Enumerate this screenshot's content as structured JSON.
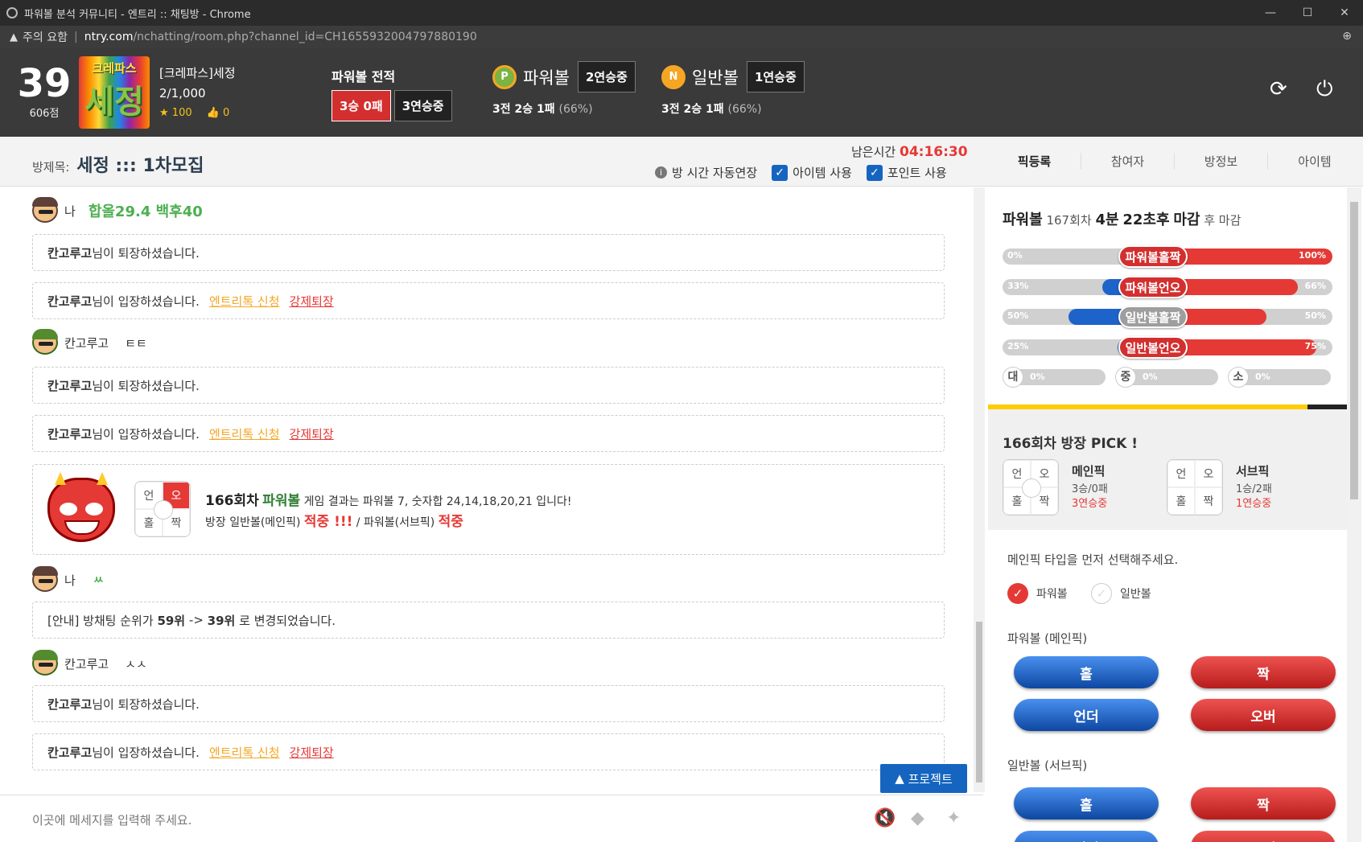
{
  "window": {
    "title": "파워볼 분석 커뮤니티 - 엔트리 :: 채팅방 - Chrome"
  },
  "address": {
    "warning": "주의 요함",
    "domain": "ntry.com",
    "path": "/nchatting/room.php?channel_id=CH1655932004797880190"
  },
  "header": {
    "rank": "39",
    "points": "606점",
    "avatar_top": "크레파스",
    "avatar_main": "세정",
    "username": "[크레파스]세정",
    "room_rank": "2/1,000",
    "stars": "100",
    "likes": "0",
    "record_title": "파워볼 전적",
    "record_badge1": "3승 0패",
    "record_badge2": "3연승중",
    "powerball": {
      "coin": "P",
      "name": "파워볼",
      "streak": "2연승중",
      "wdl": "3전 2승 1패",
      "pct": "(66%)"
    },
    "normal": {
      "coin": "N",
      "name": "일반볼",
      "streak": "1연승중",
      "wdl": "3전 2승 1패",
      "pct": "(66%)"
    }
  },
  "subbar": {
    "label": "방제목:",
    "title": "세정 ::: 1차모집",
    "timer_label": "남은시간",
    "timer": "04:16:30",
    "opt_auto": "방 시간 자동연장",
    "opt_item": "아이템 사용",
    "opt_point": "포인트 사용",
    "tabs": [
      "픽등록",
      "참여자",
      "방정보",
      "아이템"
    ]
  },
  "chat": {
    "me": "나",
    "msg1": "합올29.4 백후40",
    "leave_suffix": "님이 퇴장하셨습니다.",
    "enter_suffix": "님이 입장하셨습니다.",
    "user": "칸고루고",
    "link_apply": "엔트리톡 신청",
    "link_kick": "강제퇴장",
    "msg2": "ㅌㅌ",
    "result": {
      "round": "166회차",
      "game": "파워볼",
      "text1": "게임 결과는 파워볼 7, 숫자합 24,14,18,20,21 입니다!",
      "text2a": "방장 일반볼(메인픽)",
      "hit1": "적중 !!!",
      "text2b": "/ 파워볼(서브픽)",
      "hit2": "적중",
      "grid": [
        "언",
        "오",
        "홀",
        "짝"
      ]
    },
    "msg3": "ㅆ",
    "notice_pre": "[안내] 방채팅 순위가",
    "notice_from": "59위",
    "notice_arrow": "->",
    "notice_to": "39위",
    "notice_post": "로 변경되었습니다.",
    "msg4": "ㅅㅅ",
    "input_placeholder": "이곳에 메세지를 입력해 주세요.",
    "protect": "프로젝트"
  },
  "panel": {
    "pb_game": "파워볼",
    "pb_round": "167회차",
    "pb_min": "4분",
    "pb_sec": "22초후",
    "pb_close": "마감",
    "pb_after": "후 마감",
    "bars": [
      {
        "label": "파워볼홀짝",
        "left": "0%",
        "right": "100%",
        "blue": 0,
        "red": 1.0,
        "pill": "red"
      },
      {
        "label": "파워볼언오",
        "left": "33%",
        "right": "66%",
        "blue": 0.33,
        "red": 0.66,
        "pill": "red"
      },
      {
        "label": "일반볼홀짝",
        "left": "50%",
        "right": "50%",
        "blue": 0.5,
        "red": 0.5,
        "pill": "gray"
      },
      {
        "label": "일반볼언오",
        "left": "25%",
        "right": "75%",
        "blue": 0.25,
        "red": 0.75,
        "pill": "red"
      }
    ],
    "sizes": [
      {
        "c": "대",
        "p": "0%"
      },
      {
        "c": "중",
        "p": "0%"
      },
      {
        "c": "소",
        "p": "0%"
      }
    ],
    "pick_title": "166회차 방장 PICK !",
    "main": {
      "name": "메인픽",
      "rec": "3승/0패",
      "streak": "3연승중"
    },
    "sub": {
      "name": "서브픽",
      "rec": "1승/2패",
      "streak": "1연승중"
    },
    "grid": [
      "언",
      "오",
      "홀",
      "짝"
    ],
    "select_title": "메인픽 타입을 먼저 선택해주세요.",
    "radio1": "파워볼",
    "radio2": "일반볼",
    "pb_main_title": "파워볼 (메인픽)",
    "nb_sub_title": "일반볼 (서브픽)",
    "btn_odd": "홀",
    "btn_even": "짝",
    "btn_under": "언더",
    "btn_over": "오버"
  }
}
